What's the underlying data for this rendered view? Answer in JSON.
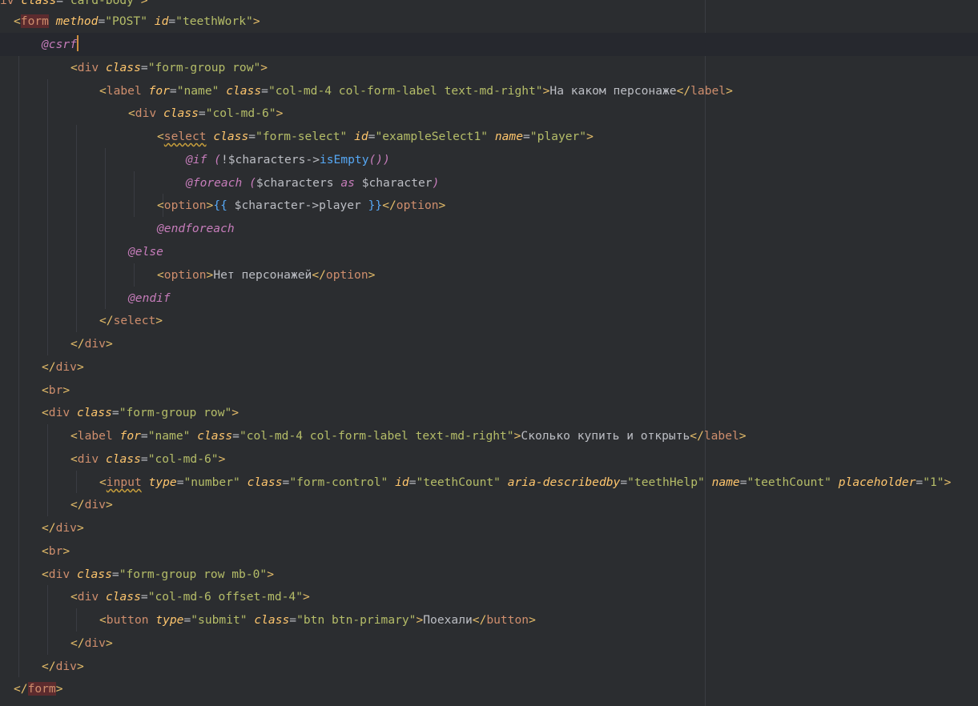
{
  "lines": [
    {
      "tokens": [
        {
          "c": "t-name",
          "t": "iv "
        },
        {
          "c": "t-attr",
          "t": "class"
        },
        {
          "c": "t-pun",
          "t": "="
        },
        {
          "c": "t-str",
          "t": "\"card-body\""
        },
        {
          "c": "t-tag",
          "t": ">"
        }
      ]
    },
    {
      "tokens": [
        {
          "c": "t-tag",
          "t": "<"
        },
        {
          "c": "t-name hl",
          "t": "form"
        },
        {
          "c": "t-pun",
          "t": " "
        },
        {
          "c": "t-attr",
          "t": "method"
        },
        {
          "c": "t-pun",
          "t": "="
        },
        {
          "c": "t-str",
          "t": "\"POST\""
        },
        {
          "c": "t-pun",
          "t": " "
        },
        {
          "c": "t-attr",
          "t": "id"
        },
        {
          "c": "t-pun",
          "t": "="
        },
        {
          "c": "t-str",
          "t": "\"teethWork\""
        },
        {
          "c": "t-tag",
          "t": ">"
        }
      ]
    },
    {
      "tokens": [
        {
          "c": "t-dir",
          "t": "@csrf"
        }
      ],
      "caret": true
    },
    {
      "tokens": [
        {
          "c": "t-tag",
          "t": "<"
        },
        {
          "c": "t-name",
          "t": "div"
        },
        {
          "c": "t-pun",
          "t": " "
        },
        {
          "c": "t-attr",
          "t": "class"
        },
        {
          "c": "t-pun",
          "t": "="
        },
        {
          "c": "t-str",
          "t": "\"form-group row\""
        },
        {
          "c": "t-tag",
          "t": ">"
        }
      ]
    },
    {
      "tokens": [
        {
          "c": "t-tag",
          "t": "<"
        },
        {
          "c": "t-name",
          "t": "label"
        },
        {
          "c": "t-pun",
          "t": " "
        },
        {
          "c": "t-attr",
          "t": "for"
        },
        {
          "c": "t-pun",
          "t": "="
        },
        {
          "c": "t-str",
          "t": "\"name\""
        },
        {
          "c": "t-pun",
          "t": " "
        },
        {
          "c": "t-attr",
          "t": "class"
        },
        {
          "c": "t-pun",
          "t": "="
        },
        {
          "c": "t-str",
          "t": "\"col-md-4 col-form-label text-md-right\""
        },
        {
          "c": "t-tag",
          "t": ">"
        },
        {
          "c": "t-text",
          "t": "На каком персонаже"
        },
        {
          "c": "t-tag",
          "t": "</"
        },
        {
          "c": "t-name",
          "t": "label"
        },
        {
          "c": "t-tag",
          "t": ">"
        }
      ]
    },
    {
      "tokens": [
        {
          "c": "t-tag",
          "t": "<"
        },
        {
          "c": "t-name",
          "t": "div"
        },
        {
          "c": "t-pun",
          "t": " "
        },
        {
          "c": "t-attr",
          "t": "class"
        },
        {
          "c": "t-pun",
          "t": "="
        },
        {
          "c": "t-str",
          "t": "\"col-md-6\""
        },
        {
          "c": "t-tag",
          "t": ">"
        }
      ]
    },
    {
      "tokens": [
        {
          "c": "t-tag",
          "t": "<"
        },
        {
          "c": "t-name squiggle",
          "t": "select"
        },
        {
          "c": "t-pun",
          "t": " "
        },
        {
          "c": "t-attr",
          "t": "class"
        },
        {
          "c": "t-pun",
          "t": "="
        },
        {
          "c": "t-str",
          "t": "\"form-select\""
        },
        {
          "c": "t-pun",
          "t": " "
        },
        {
          "c": "t-attr",
          "t": "id"
        },
        {
          "c": "t-pun",
          "t": "="
        },
        {
          "c": "t-str",
          "t": "\"exampleSelect1\""
        },
        {
          "c": "t-pun",
          "t": " "
        },
        {
          "c": "t-attr",
          "t": "name"
        },
        {
          "c": "t-pun",
          "t": "="
        },
        {
          "c": "t-str",
          "t": "\"player\""
        },
        {
          "c": "t-tag",
          "t": ">"
        }
      ]
    },
    {
      "tokens": [
        {
          "c": "t-dir",
          "t": "@if"
        },
        {
          "c": "t-pun",
          "t": " "
        },
        {
          "c": "t-kw",
          "t": "("
        },
        {
          "c": "t-pun",
          "t": "!"
        },
        {
          "c": "t-var",
          "t": "$characters"
        },
        {
          "c": "t-pun",
          "t": "->"
        },
        {
          "c": "t-fn",
          "t": "isEmpty"
        },
        {
          "c": "t-kw",
          "t": "())"
        }
      ]
    },
    {
      "tokens": [
        {
          "c": "t-dir",
          "t": "@foreach"
        },
        {
          "c": "t-pun",
          "t": " "
        },
        {
          "c": "t-kw",
          "t": "("
        },
        {
          "c": "t-var",
          "t": "$characters "
        },
        {
          "c": "t-kw",
          "t": "as"
        },
        {
          "c": "t-var",
          "t": " $character"
        },
        {
          "c": "t-kw",
          "t": ")"
        }
      ]
    },
    {
      "tokens": [
        {
          "c": "t-tag",
          "t": "<"
        },
        {
          "c": "t-name",
          "t": "option"
        },
        {
          "c": "t-tag",
          "t": ">"
        },
        {
          "c": "t-fn",
          "t": "{{ "
        },
        {
          "c": "t-var",
          "t": "$character"
        },
        {
          "c": "t-pun",
          "t": "->"
        },
        {
          "c": "t-var",
          "t": "player "
        },
        {
          "c": "t-fn",
          "t": "}}"
        },
        {
          "c": "t-tag",
          "t": "</"
        },
        {
          "c": "t-name",
          "t": "option"
        },
        {
          "c": "t-tag",
          "t": ">"
        }
      ]
    },
    {
      "tokens": [
        {
          "c": "t-dir",
          "t": "@endforeach"
        }
      ]
    },
    {
      "tokens": [
        {
          "c": "t-dir",
          "t": "@else"
        }
      ]
    },
    {
      "tokens": [
        {
          "c": "t-tag",
          "t": "<"
        },
        {
          "c": "t-name",
          "t": "option"
        },
        {
          "c": "t-tag",
          "t": ">"
        },
        {
          "c": "t-text",
          "t": "Нет персонажей"
        },
        {
          "c": "t-tag",
          "t": "</"
        },
        {
          "c": "t-name",
          "t": "option"
        },
        {
          "c": "t-tag",
          "t": ">"
        }
      ]
    },
    {
      "tokens": [
        {
          "c": "t-dir",
          "t": "@endif"
        }
      ]
    },
    {
      "tokens": [
        {
          "c": "t-tag",
          "t": "</"
        },
        {
          "c": "t-name",
          "t": "select"
        },
        {
          "c": "t-tag",
          "t": ">"
        }
      ]
    },
    {
      "tokens": [
        {
          "c": "t-tag",
          "t": "</"
        },
        {
          "c": "t-name",
          "t": "div"
        },
        {
          "c": "t-tag",
          "t": ">"
        }
      ]
    },
    {
      "tokens": [
        {
          "c": "t-tag",
          "t": "</"
        },
        {
          "c": "t-name",
          "t": "div"
        },
        {
          "c": "t-tag",
          "t": ">"
        }
      ]
    },
    {
      "tokens": [
        {
          "c": "t-tag",
          "t": "<"
        },
        {
          "c": "t-name",
          "t": "br"
        },
        {
          "c": "t-tag",
          "t": ">"
        }
      ]
    },
    {
      "tokens": [
        {
          "c": "t-tag",
          "t": "<"
        },
        {
          "c": "t-name",
          "t": "div"
        },
        {
          "c": "t-pun",
          "t": " "
        },
        {
          "c": "t-attr",
          "t": "class"
        },
        {
          "c": "t-pun",
          "t": "="
        },
        {
          "c": "t-str",
          "t": "\"form-group row\""
        },
        {
          "c": "t-tag",
          "t": ">"
        }
      ]
    },
    {
      "tokens": [
        {
          "c": "t-tag",
          "t": "<"
        },
        {
          "c": "t-name",
          "t": "label"
        },
        {
          "c": "t-pun",
          "t": " "
        },
        {
          "c": "t-attr",
          "t": "for"
        },
        {
          "c": "t-pun",
          "t": "="
        },
        {
          "c": "t-str",
          "t": "\"name\""
        },
        {
          "c": "t-pun",
          "t": " "
        },
        {
          "c": "t-attr",
          "t": "class"
        },
        {
          "c": "t-pun",
          "t": "="
        },
        {
          "c": "t-str",
          "t": "\"col-md-4 col-form-label text-md-right\""
        },
        {
          "c": "t-tag",
          "t": ">"
        },
        {
          "c": "t-text",
          "t": "Сколько купить и открыть"
        },
        {
          "c": "t-tag",
          "t": "</"
        },
        {
          "c": "t-name",
          "t": "label"
        },
        {
          "c": "t-tag",
          "t": ">"
        }
      ]
    },
    {
      "tokens": [
        {
          "c": "t-tag",
          "t": "<"
        },
        {
          "c": "t-name",
          "t": "div"
        },
        {
          "c": "t-pun",
          "t": " "
        },
        {
          "c": "t-attr",
          "t": "class"
        },
        {
          "c": "t-pun",
          "t": "="
        },
        {
          "c": "t-str",
          "t": "\"col-md-6\""
        },
        {
          "c": "t-tag",
          "t": ">"
        }
      ]
    },
    {
      "tokens": [
        {
          "c": "t-tag",
          "t": "<"
        },
        {
          "c": "t-name squiggle",
          "t": "input"
        },
        {
          "c": "t-pun",
          "t": " "
        },
        {
          "c": "t-attr",
          "t": "type"
        },
        {
          "c": "t-pun",
          "t": "="
        },
        {
          "c": "t-str",
          "t": "\"number\""
        },
        {
          "c": "t-pun",
          "t": " "
        },
        {
          "c": "t-attr",
          "t": "class"
        },
        {
          "c": "t-pun",
          "t": "="
        },
        {
          "c": "t-str",
          "t": "\"form-control\""
        },
        {
          "c": "t-pun",
          "t": " "
        },
        {
          "c": "t-attr",
          "t": "id"
        },
        {
          "c": "t-pun",
          "t": "="
        },
        {
          "c": "t-str",
          "t": "\"teethCount\""
        },
        {
          "c": "t-pun",
          "t": " "
        },
        {
          "c": "t-attr",
          "t": "aria-describedby"
        },
        {
          "c": "t-pun",
          "t": "="
        },
        {
          "c": "t-str",
          "t": "\"teethHelp\""
        },
        {
          "c": "t-pun",
          "t": " "
        },
        {
          "c": "t-attr",
          "t": "name"
        },
        {
          "c": "t-pun",
          "t": "="
        },
        {
          "c": "t-str",
          "t": "\"teethCount\""
        },
        {
          "c": "t-pun",
          "t": " "
        },
        {
          "c": "t-attr",
          "t": "placeholder"
        },
        {
          "c": "t-pun",
          "t": "="
        },
        {
          "c": "t-str",
          "t": "\"1\""
        },
        {
          "c": "t-tag",
          "t": ">"
        }
      ]
    },
    {
      "tokens": [
        {
          "c": "t-tag",
          "t": "</"
        },
        {
          "c": "t-name",
          "t": "div"
        },
        {
          "c": "t-tag",
          "t": ">"
        }
      ]
    },
    {
      "tokens": [
        {
          "c": "t-tag",
          "t": "</"
        },
        {
          "c": "t-name",
          "t": "div"
        },
        {
          "c": "t-tag",
          "t": ">"
        }
      ]
    },
    {
      "tokens": [
        {
          "c": "t-tag",
          "t": "<"
        },
        {
          "c": "t-name",
          "t": "br"
        },
        {
          "c": "t-tag",
          "t": ">"
        }
      ]
    },
    {
      "tokens": [
        {
          "c": "t-tag",
          "t": "<"
        },
        {
          "c": "t-name",
          "t": "div"
        },
        {
          "c": "t-pun",
          "t": " "
        },
        {
          "c": "t-attr",
          "t": "class"
        },
        {
          "c": "t-pun",
          "t": "="
        },
        {
          "c": "t-str",
          "t": "\"form-group row mb-0\""
        },
        {
          "c": "t-tag",
          "t": ">"
        }
      ]
    },
    {
      "tokens": [
        {
          "c": "t-tag",
          "t": "<"
        },
        {
          "c": "t-name",
          "t": "div"
        },
        {
          "c": "t-pun",
          "t": " "
        },
        {
          "c": "t-attr",
          "t": "class"
        },
        {
          "c": "t-pun",
          "t": "="
        },
        {
          "c": "t-str",
          "t": "\"col-md-6 offset-md-4\""
        },
        {
          "c": "t-tag",
          "t": ">"
        }
      ]
    },
    {
      "tokens": [
        {
          "c": "t-tag",
          "t": "<"
        },
        {
          "c": "t-name",
          "t": "button"
        },
        {
          "c": "t-pun",
          "t": " "
        },
        {
          "c": "t-attr",
          "t": "type"
        },
        {
          "c": "t-pun",
          "t": "="
        },
        {
          "c": "t-str",
          "t": "\"submit\""
        },
        {
          "c": "t-pun",
          "t": " "
        },
        {
          "c": "t-attr",
          "t": "class"
        },
        {
          "c": "t-pun",
          "t": "="
        },
        {
          "c": "t-str",
          "t": "\"btn btn-primary\""
        },
        {
          "c": "t-tag",
          "t": ">"
        },
        {
          "c": "t-text",
          "t": "Поехали"
        },
        {
          "c": "t-tag",
          "t": "</"
        },
        {
          "c": "t-name",
          "t": "button"
        },
        {
          "c": "t-tag",
          "t": ">"
        }
      ]
    },
    {
      "tokens": [
        {
          "c": "t-tag",
          "t": "</"
        },
        {
          "c": "t-name",
          "t": "div"
        },
        {
          "c": "t-tag",
          "t": ">"
        }
      ]
    },
    {
      "tokens": [
        {
          "c": "t-tag",
          "t": "</"
        },
        {
          "c": "t-name",
          "t": "div"
        },
        {
          "c": "t-tag",
          "t": ">"
        }
      ]
    },
    {
      "tokens": [
        {
          "c": "t-tag",
          "t": "</"
        },
        {
          "c": "t-name hl",
          "t": "form"
        },
        {
          "c": "t-tag",
          "t": ">"
        }
      ]
    }
  ],
  "colors": {
    "background": "#2b2d30",
    "current_line": "#26282e",
    "tag_name": "#cf8e6d",
    "attribute": "#ffc66d",
    "string": "#b5bd68",
    "directive": "#c77dbb",
    "function": "#56a8f5",
    "text": "#bcbec4",
    "caret": "#ce8e3d",
    "tag_highlight": "#5c2b2e"
  }
}
